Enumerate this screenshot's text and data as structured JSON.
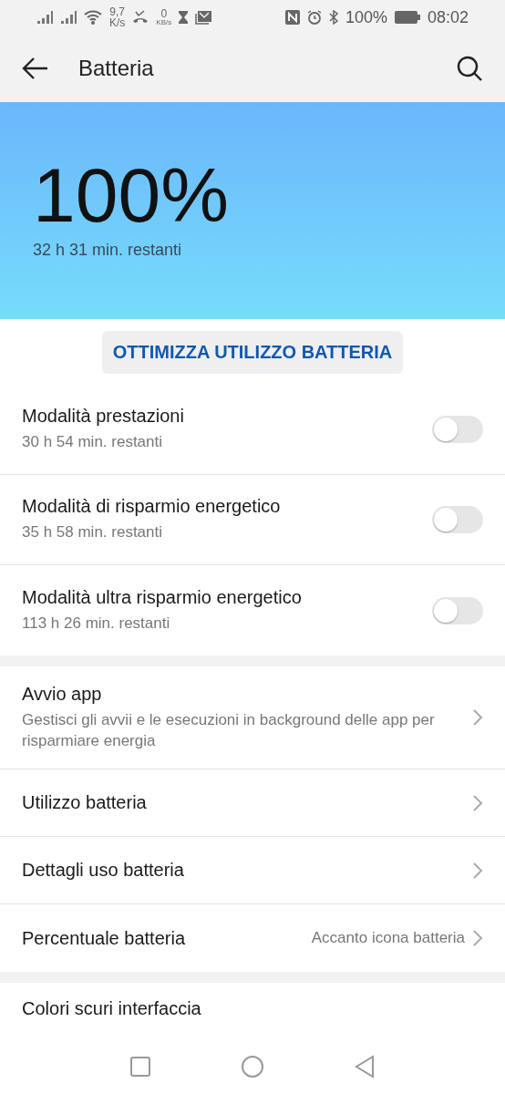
{
  "status_bar": {
    "speed_value": "9,7",
    "speed_unit": "K/s",
    "data_value": "0",
    "data_unit": "KB/s",
    "battery": "100%",
    "time": "08:02"
  },
  "app_bar": {
    "title": "Batteria"
  },
  "header": {
    "percent": "100%",
    "remaining": "32 h 31 min. restanti"
  },
  "optimize_button": "OTTIMIZZA UTILIZZO BATTERIA",
  "modes": [
    {
      "title": "Modalità prestazioni",
      "subtitle": "30 h 54 min. restanti",
      "on": false
    },
    {
      "title": "Modalità di risparmio energetico",
      "subtitle": "35 h 58 min. restanti",
      "on": false
    },
    {
      "title": "Modalità ultra risparmio energetico",
      "subtitle": "113 h 26 min. restanti",
      "on": false
    }
  ],
  "settings": [
    {
      "title": "Avvio app",
      "subtitle": "Gestisci gli avvii e le esecuzioni in background delle app per risparmiare energia"
    },
    {
      "title": "Utilizzo batteria"
    },
    {
      "title": "Dettagli uso batteria"
    },
    {
      "title": "Percentuale batteria",
      "value": "Accanto icona batteria"
    }
  ],
  "partial_item": {
    "title": "Colori scuri interfaccia"
  }
}
